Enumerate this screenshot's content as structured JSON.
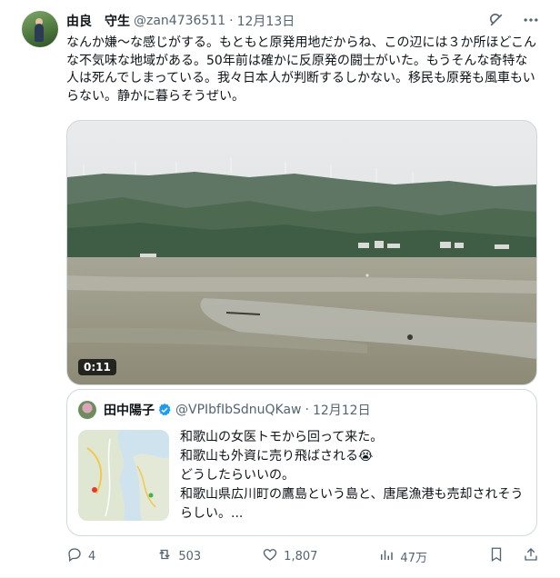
{
  "tweet": {
    "author_name": "由良　守生",
    "handle": "@zan4736511",
    "separator": "·",
    "date": "12月13日",
    "text": "なんか嫌〜な感じがする。もともと原発用地だからね、この辺には３か所ほどこんな不気味な地域がある。50年前は確かに反原発の闘士がいた。もうそんな奇特な人は死んでしまっている。我々日本人が判断するしかない。移民も原発も風車もいらない。静かに暮らそうぜい。",
    "video_duration": "0:11"
  },
  "quote": {
    "author_name": "田中陽子",
    "handle": "@VPIbfIbSdnuQKaw",
    "separator": "·",
    "date": "12月12日",
    "lines": [
      "和歌山の女医トモから回って来た。",
      "和歌山も外資に売り飛ばされる😭",
      "どうしたらいいの。",
      "和歌山県広川町の鷹島という島と、唐尾漁港も売却されそうらしい。..."
    ]
  },
  "actions": {
    "replies": "4",
    "reposts": "503",
    "likes": "1,807",
    "views": "47万"
  },
  "icons": {
    "grok": "grok-icon",
    "more": "more-icon",
    "reply": "reply-icon",
    "repost": "repost-icon",
    "like": "like-icon",
    "views": "views-icon",
    "bookmark": "bookmark-icon",
    "share": "share-icon",
    "verified": "verified-badge-icon"
  },
  "colors": {
    "text": "#0f1419",
    "secondary": "#536471",
    "border": "#cfd9de",
    "verified": "#1d9bf0"
  }
}
